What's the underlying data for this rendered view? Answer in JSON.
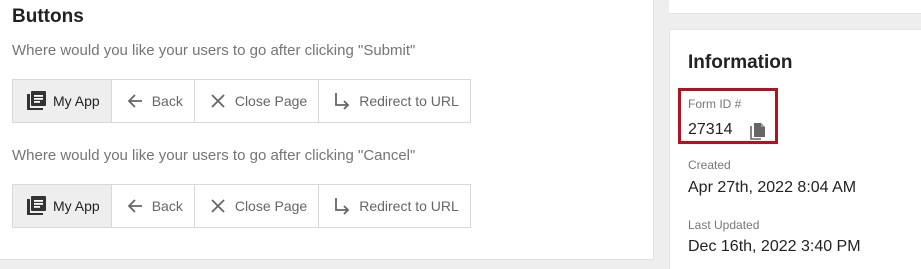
{
  "buttons_section": {
    "title": "Buttons",
    "submit_question": "Where would you like your users to go after clicking \"Submit\"",
    "cancel_question": "Where would you like your users to go after clicking \"Cancel\"",
    "submit_options": [
      {
        "label": "My App",
        "icon": "app-list-icon",
        "selected": true
      },
      {
        "label": "Back",
        "icon": "arrow-left-icon",
        "selected": false
      },
      {
        "label": "Close Page",
        "icon": "close-icon",
        "selected": false
      },
      {
        "label": "Redirect to URL",
        "icon": "redirect-arrow-icon",
        "selected": false
      }
    ],
    "cancel_options": [
      {
        "label": "My App",
        "icon": "app-list-icon",
        "selected": true
      },
      {
        "label": "Back",
        "icon": "arrow-left-icon",
        "selected": false
      },
      {
        "label": "Close Page",
        "icon": "close-icon",
        "selected": false
      },
      {
        "label": "Redirect to URL",
        "icon": "redirect-arrow-icon",
        "selected": false
      }
    ]
  },
  "information": {
    "title": "Information",
    "form_id_label": "Form ID #",
    "form_id_value": "27314",
    "copy_icon": "copy-icon",
    "created_label": "Created",
    "created_value": "Apr 27th, 2022 8:04 AM",
    "updated_label": "Last Updated",
    "updated_value": "Dec 16th, 2022 3:40 PM"
  },
  "colors": {
    "highlight": "#b0121f",
    "selected_bg": "#eeeeee",
    "page_bg": "#eeeeee"
  }
}
